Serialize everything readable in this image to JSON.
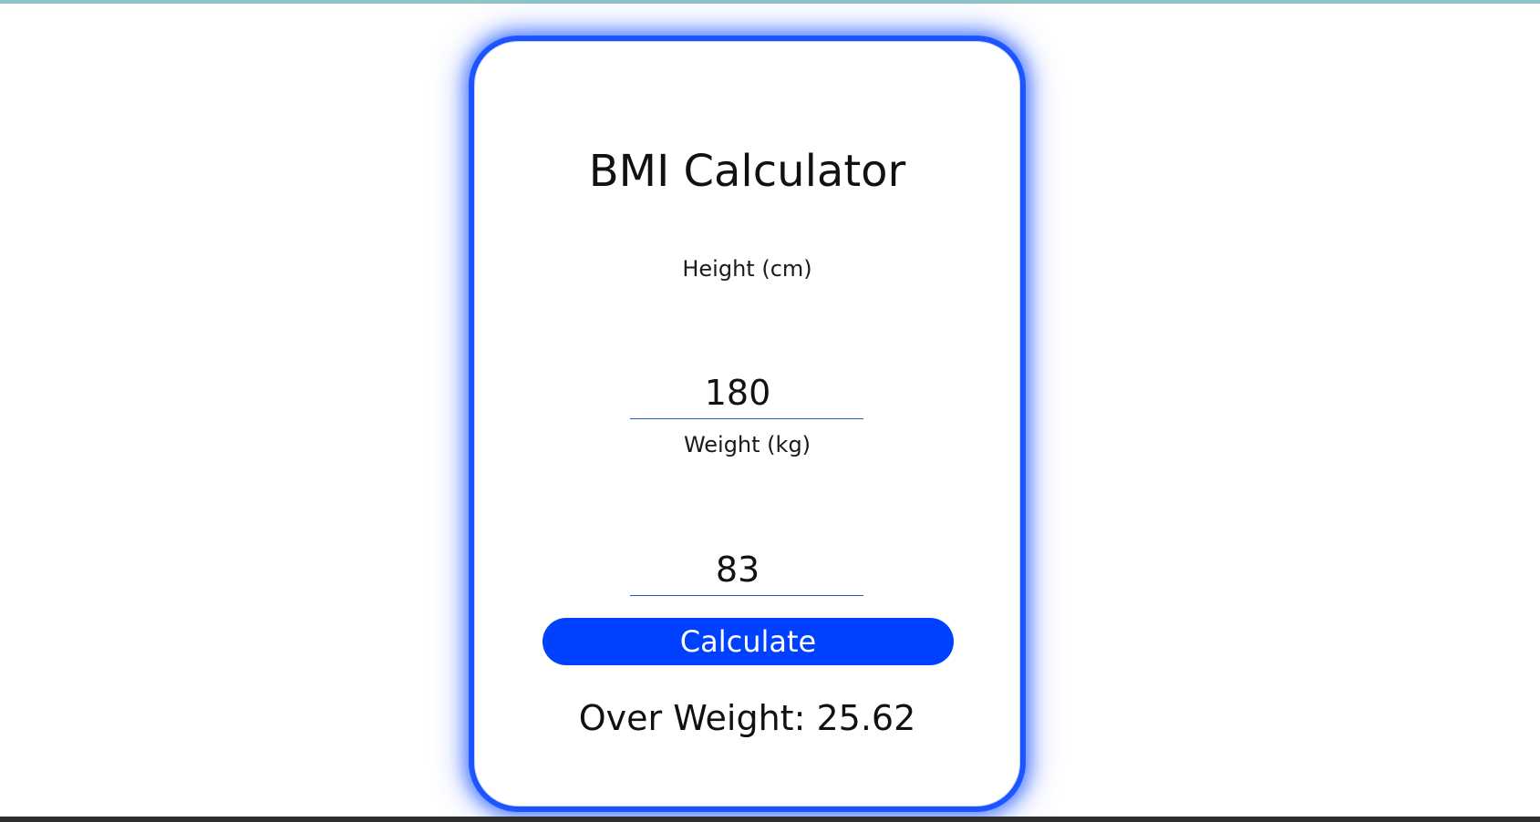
{
  "app": {
    "title": "BMI Calculator",
    "colors": {
      "accent": "#0040ff",
      "underline": "#1e5cc8",
      "background": "#ffffff"
    }
  },
  "form": {
    "height": {
      "label": "Height (cm)",
      "value": "180"
    },
    "weight": {
      "label": "Weight (kg)",
      "value": "83"
    },
    "calculate_label": "Calculate"
  },
  "result": {
    "text": "Over Weight: 25.62"
  }
}
